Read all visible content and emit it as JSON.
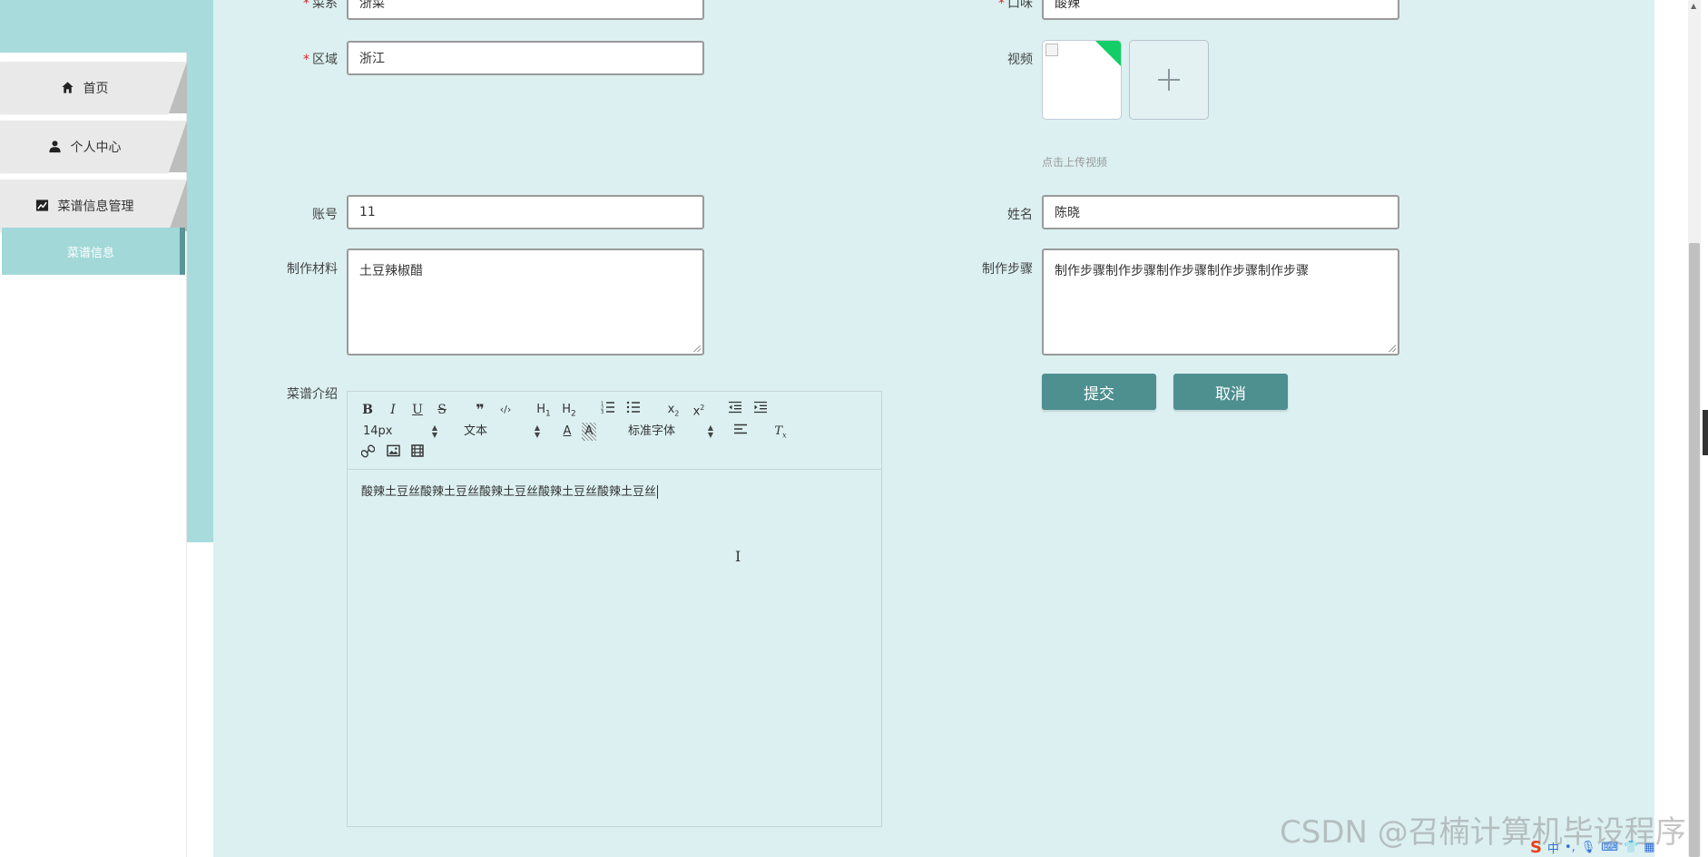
{
  "sidebar": {
    "items": [
      {
        "label": "首页",
        "icon": "home-icon"
      },
      {
        "label": "个人中心",
        "icon": "user-icon"
      },
      {
        "label": "菜谱信息管理",
        "icon": "chart-icon"
      }
    ],
    "submenu_label": "菜谱信息"
  },
  "form": {
    "cuisine": {
      "label": "菜系",
      "value": "浙菜"
    },
    "flavor": {
      "label": "口味",
      "value": "酸辣"
    },
    "region": {
      "label": "区域",
      "value": "浙江"
    },
    "video": {
      "label": "视频",
      "hint": "点击上传视频"
    },
    "account": {
      "label": "账号",
      "value": "11"
    },
    "name": {
      "label": "姓名",
      "value": "陈晓"
    },
    "materials": {
      "label": "制作材料",
      "value": "土豆辣椒醋"
    },
    "steps": {
      "label": "制作步骤",
      "value": "制作步骤制作步骤制作步骤制作步骤制作步骤"
    },
    "intro": {
      "label": "菜谱介绍"
    },
    "required_mark": "*"
  },
  "editor": {
    "toolbar_row1": [
      "B",
      "I",
      "U",
      "S",
      "99",
      "</>",
      "H1",
      "H2",
      "ol",
      "ul",
      "x2-sub",
      "x2-sup",
      "outdent",
      "indent"
    ],
    "font_size": "14px",
    "text_type": "文本",
    "font_family": "标准字体",
    "content": "酸辣土豆丝酸辣土豆丝酸辣土豆丝酸辣土豆丝酸辣土豆丝"
  },
  "buttons": {
    "submit": "提交",
    "cancel": "取消"
  },
  "watermark": "CSDN @召楠计算机毕设程序",
  "ime": {
    "lang": "中"
  }
}
